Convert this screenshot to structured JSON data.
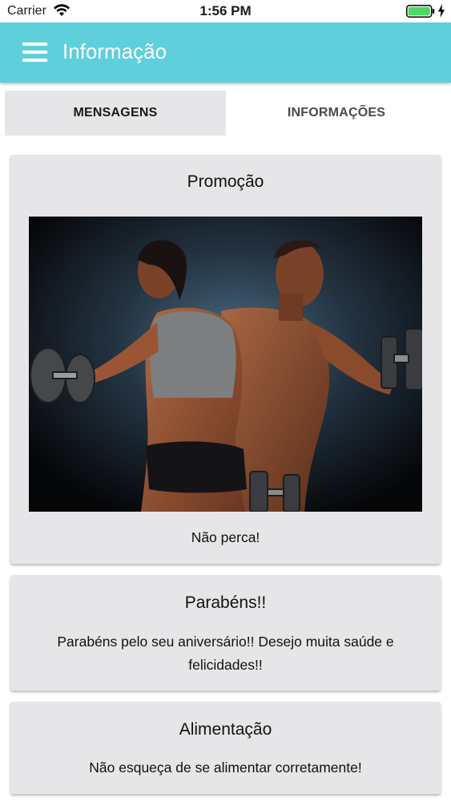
{
  "status_bar": {
    "carrier": "Carrier",
    "time": "1:56 PM",
    "battery_color": "#4cd964"
  },
  "header": {
    "title": "Informação",
    "background": "#5fcfdb"
  },
  "tabs": [
    {
      "label": "MENSAGENS",
      "selected": true
    },
    {
      "label": "INFORMAÇÕES",
      "selected": false
    }
  ],
  "cards": [
    {
      "title": "Promoção",
      "body": "Não perca!",
      "has_image": true
    },
    {
      "title": "Parabéns!!",
      "body": "Parabéns pelo seu aniversário!! Desejo muita saúde e felicidades!!",
      "has_image": false
    },
    {
      "title": "Alimentação",
      "body": "Não esqueça de se alimentar corretamente!",
      "has_image": false
    }
  ]
}
